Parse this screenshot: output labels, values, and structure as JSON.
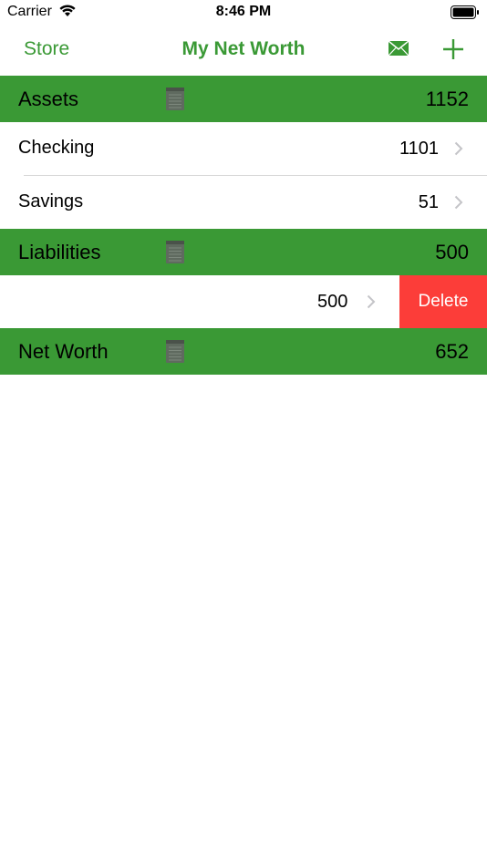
{
  "status": {
    "carrier": "Carrier",
    "time": "8:46 PM"
  },
  "nav": {
    "left": "Store",
    "title": "My Net Worth",
    "mail_icon": "mail-icon",
    "add_icon": "plus-icon"
  },
  "colors": {
    "accent": "#3a9935",
    "delete": "#fc3d39",
    "separator": "#d8d8d8"
  },
  "assets": {
    "label": "Assets",
    "total": "1152",
    "items": [
      {
        "label": "Checking",
        "value": "1101"
      },
      {
        "label": "Savings",
        "value": "51"
      }
    ]
  },
  "liabilities": {
    "label": "Liabilities",
    "total": "500",
    "items": [
      {
        "label": "",
        "value": "500",
        "action": "Delete"
      }
    ]
  },
  "net_worth": {
    "label": "Net Worth",
    "total": "652"
  }
}
